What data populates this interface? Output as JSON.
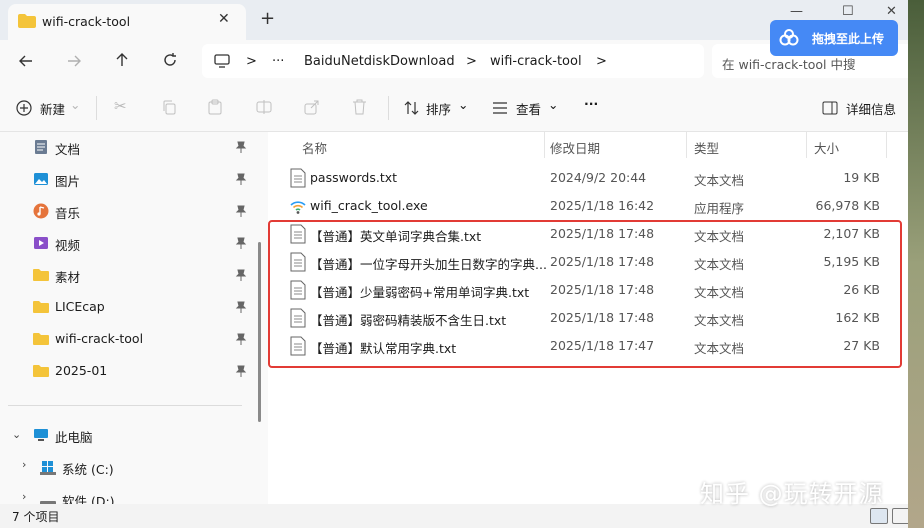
{
  "window": {
    "tab_title": "wifi-crack-tool",
    "tab_close": "✕",
    "new_tab": "+",
    "minimize": "—",
    "maximize": "☐",
    "close": "✕"
  },
  "baidu": {
    "label": "拖拽至此上传",
    "color": "#4589f5"
  },
  "address": {
    "more": "···",
    "crumbs": [
      "BaiduNetdiskDownload",
      "wifi-crack-tool"
    ],
    "separator": ">",
    "search_placeholder": "在 wifi-crack-tool 中搜"
  },
  "toolbar": {
    "new_label": "新建",
    "sort_label": "排序",
    "view_label": "查看",
    "more": "···",
    "details_label": "详细信息"
  },
  "sidebar": {
    "quick_access": [
      {
        "label": "文档",
        "icon": "document-icon"
      },
      {
        "label": "图片",
        "icon": "picture-icon"
      },
      {
        "label": "音乐",
        "icon": "music-icon"
      },
      {
        "label": "视频",
        "icon": "video-icon"
      },
      {
        "label": "素材",
        "icon": "folder-icon"
      },
      {
        "label": "LICEcap",
        "icon": "folder-icon"
      },
      {
        "label": "wifi-crack-tool",
        "icon": "folder-icon"
      },
      {
        "label": "2025-01",
        "icon": "folder-icon"
      }
    ],
    "this_pc": "此电脑",
    "drives": [
      "系统 (C:)",
      "软件 (D:)"
    ]
  },
  "columns": {
    "name": "名称",
    "modified": "修改日期",
    "type": "类型",
    "size": "大小"
  },
  "files": [
    {
      "name": "passwords.txt",
      "modified": "2024/9/2 20:44",
      "type": "文本文档",
      "size": "19 KB",
      "icon": "text-file-icon"
    },
    {
      "name": "wifi_crack_tool.exe",
      "modified": "2025/1/18 16:42",
      "type": "应用程序",
      "size": "66,978 KB",
      "icon": "wifi-app-icon"
    },
    {
      "name": "【普通】英文单词字典合集.txt",
      "modified": "2025/1/18 17:48",
      "type": "文本文档",
      "size": "2,107 KB",
      "icon": "text-file-icon"
    },
    {
      "name": "【普通】一位字母开头加生日数字的字典...",
      "modified": "2025/1/18 17:48",
      "type": "文本文档",
      "size": "5,195 KB",
      "icon": "text-file-icon"
    },
    {
      "name": "【普通】少量弱密码+常用单词字典.txt",
      "modified": "2025/1/18 17:48",
      "type": "文本文档",
      "size": "26 KB",
      "icon": "text-file-icon"
    },
    {
      "name": "【普通】弱密码精装版不含生日.txt",
      "modified": "2025/1/18 17:48",
      "type": "文本文档",
      "size": "162 KB",
      "icon": "text-file-icon"
    },
    {
      "name": "【普通】默认常用字典.txt",
      "modified": "2025/1/18 17:47",
      "type": "文本文档",
      "size": "27 KB",
      "icon": "text-file-icon"
    }
  ],
  "status": {
    "count": "7 个项目"
  },
  "watermark": "知乎 @玩转开源",
  "colors": {
    "highlight_border": "#e23b35",
    "folder": "#f4c43a"
  }
}
